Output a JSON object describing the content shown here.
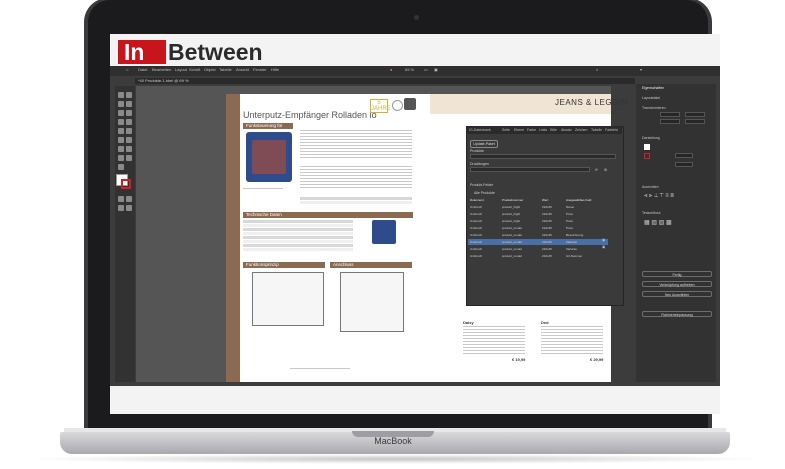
{
  "device": {
    "brand_label": "MacBook"
  },
  "logo": {
    "part1": "In",
    "part2": "Between"
  },
  "app": {
    "menu": [
      "Datei",
      "Bearbeiten",
      "Layout",
      "Schrift",
      "Objekt",
      "Tabelle",
      "Ansicht",
      "Fenster",
      "Hilfe"
    ],
    "zoom": "69 %",
    "tab_title": "*40 Produkte-1.idml @ 69 %",
    "doc_title": "Unterputz-Empfänger Rolladen io",
    "doc_badge": "5 JAHRE",
    "sections": {
      "s1": "Funksteuerung für Rollläden",
      "s2": "Technische Daten",
      "s3": "Funktionsprinzip",
      "s4": "Anschluss"
    },
    "right_page_title": "JEANS & LEGGIN",
    "right_products": [
      {
        "name": "Daisy",
        "price": "€ 19,99"
      },
      {
        "name": "Ded",
        "price": "€ 29,99"
      }
    ]
  },
  "panel": {
    "tabs": [
      "IG-Datenbank",
      "Seite",
      "Ebene",
      "Farbe",
      "Links",
      "Stile",
      "Absatz",
      "Zeichen",
      "Tabelle",
      "Farbfeld"
    ],
    "button": "Update-Paket",
    "label_rows": [
      "Produkte",
      "Druckbogen",
      "Produkt-Felder"
    ],
    "subheader": "Alle Produkte",
    "columns": [
      "Dokument",
      "Produktnummer",
      "Wert",
      "Ausgewähltes Feld"
    ],
    "rows": [
      [
        "Umbruch",
        "product_highl",
        "210x45",
        "Name"
      ],
      [
        "Umbruch",
        "product_highl",
        "210x45",
        "Preis"
      ],
      [
        "Umbruch",
        "product_highl",
        "210x45",
        "Preis"
      ],
      [
        "Umbruch",
        "product_model",
        "210x45",
        "Preis"
      ],
      [
        "Umbruch",
        "product_model",
        "210x45",
        "Bezeichnung"
      ],
      [
        "Umbruch",
        "product_model",
        "210x45",
        "Material"
      ],
      [
        "Umbruch",
        "product_model",
        "210x45",
        "Variante"
      ],
      [
        "Umbruch",
        "product_model",
        "210x45",
        "Art-Nummer"
      ]
    ]
  },
  "right_panel": {
    "header": "Eigenschaften",
    "subheader": "Layoutdatei",
    "sections": [
      "Transformieren",
      "Darstellung",
      "Ausrichten",
      "Textumfluss"
    ],
    "buttons": [
      "Fertig",
      "Verknüpfung aufheben",
      "Neu Auswählen",
      "Rahmeneinpassung"
    ]
  }
}
